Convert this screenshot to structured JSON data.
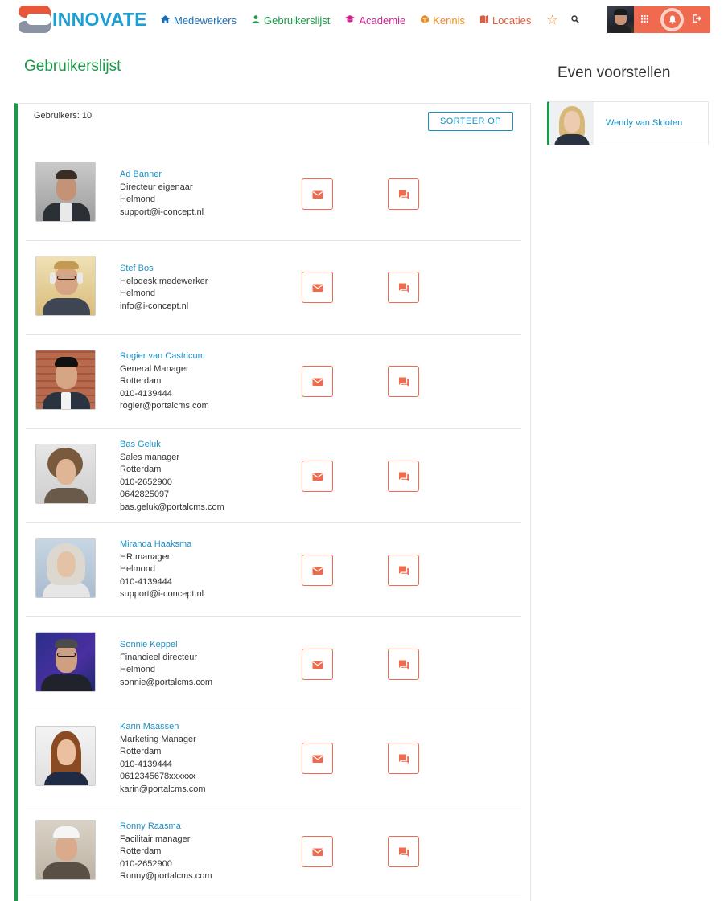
{
  "brand": {
    "logo_text": "INNOVATE"
  },
  "nav": {
    "items": [
      {
        "label": "Medewerkers",
        "icon": "home-icon"
      },
      {
        "label": "Gebruikerslijst",
        "icon": "person-icon"
      },
      {
        "label": "Academie",
        "icon": "graduation-cap-icon"
      },
      {
        "label": "Kennis",
        "icon": "box-icon"
      },
      {
        "label": "Locaties",
        "icon": "map-icon"
      }
    ],
    "favorites_icon": "star-icon",
    "search_icon": "search-icon"
  },
  "page_title": "Gebruikerslijst",
  "sidebar": {
    "title": "Even voorstellen",
    "person_name": "Wendy van Slooten"
  },
  "userlist": {
    "count_label": "Gebruikers: 10",
    "sort_label": "SORTEER OP",
    "users": [
      {
        "name": "Ad Banner",
        "lines": [
          "Directeur eigenaar",
          "Helmond",
          "support@i-concept.nl"
        ]
      },
      {
        "name": "Stef Bos",
        "lines": [
          "Helpdesk medewerker",
          "Helmond",
          "info@i-concept.nl"
        ]
      },
      {
        "name": "Rogier van Castricum",
        "lines": [
          "General Manager",
          "Rotterdam",
          "010-4139444",
          "rogier@portalcms.com"
        ]
      },
      {
        "name": "Bas Geluk",
        "lines": [
          "Sales manager",
          "Rotterdam",
          "010-2652900",
          "0642825097",
          "bas.geluk@portalcms.com"
        ]
      },
      {
        "name": "Miranda Haaksma",
        "lines": [
          "HR manager",
          "Helmond",
          "010-4139444",
          "support@i-concept.nl"
        ]
      },
      {
        "name": "Sonnie Keppel",
        "lines": [
          "Financieel directeur",
          "Helmond",
          "sonnie@portalcms.com"
        ]
      },
      {
        "name": "Karin Maassen",
        "lines": [
          "Marketing Manager",
          "Rotterdam",
          "010-4139444",
          "0612345678xxxxxx",
          "karin@portalcms.com"
        ]
      },
      {
        "name": "Ronny Raasma",
        "lines": [
          "Facilitair manager",
          "Rotterdam",
          "010-2652900",
          "Ronny@portalcms.com"
        ]
      }
    ]
  },
  "colors": {
    "brand_blue": "#1e9fd4",
    "green": "#1a9a47",
    "accent_orange": "#ef6a4e",
    "link_blue": "#1c8fc2"
  }
}
